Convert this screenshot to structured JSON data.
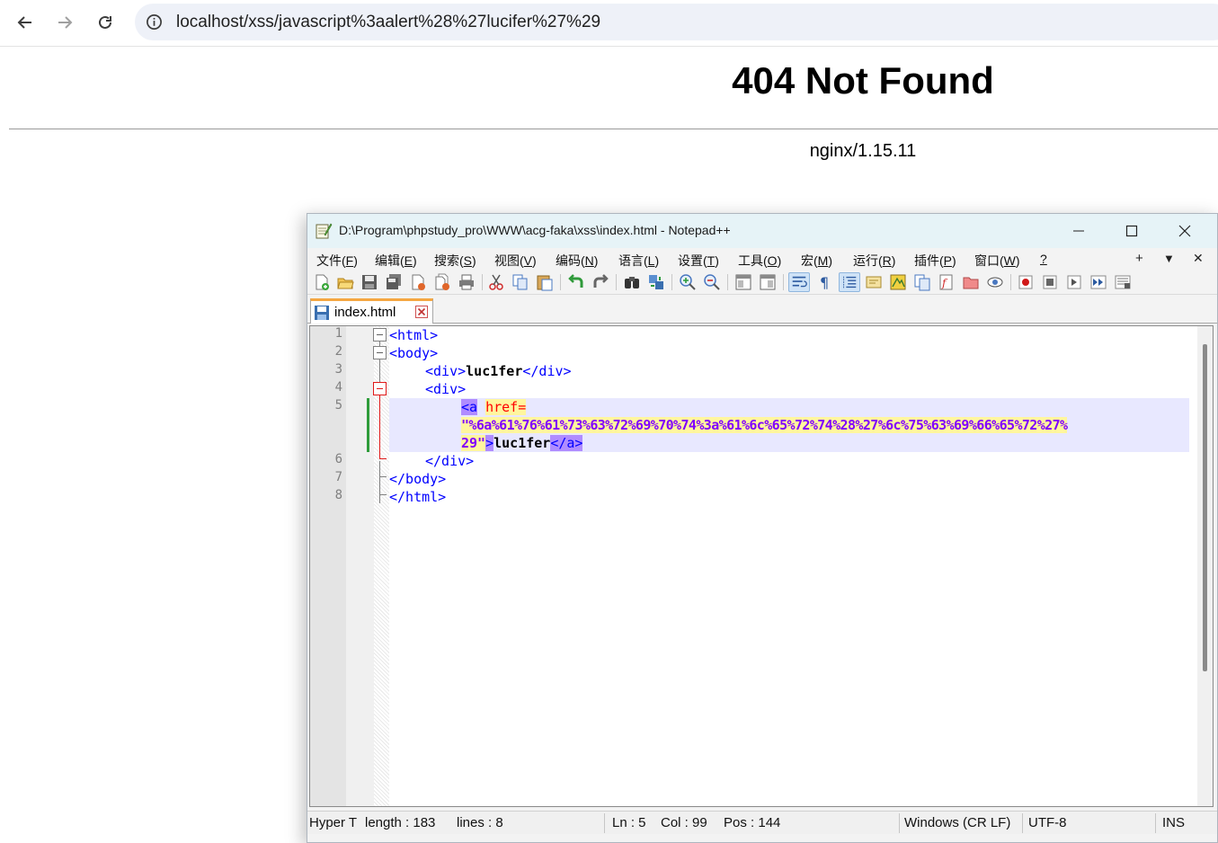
{
  "browser": {
    "url": "localhost/xss/javascript%3aalert%28%27lucifer%27%29"
  },
  "page": {
    "title": "404 Not Found",
    "server": "nginx/1.15.11"
  },
  "notepad": {
    "title": "D:\\Program\\phpstudy_pro\\WWW\\acg-faka\\xss\\index.html - Notepad++",
    "menu": [
      {
        "label": "文件(",
        "key": "F",
        "close": ")"
      },
      {
        "label": "编辑(",
        "key": "E",
        "close": ")"
      },
      {
        "label": "搜索(",
        "key": "S",
        "close": ")"
      },
      {
        "label": "视图(",
        "key": "V",
        "close": ")"
      },
      {
        "label": "编码(",
        "key": "N",
        "close": ")"
      },
      {
        "label": "语言(",
        "key": "L",
        "close": ")"
      },
      {
        "label": "设置(",
        "key": "T",
        "close": ")"
      },
      {
        "label": "工具(",
        "key": "O",
        "close": ")"
      },
      {
        "label": "宏(",
        "key": "M",
        "close": ")"
      },
      {
        "label": "运行(",
        "key": "R",
        "close": ")"
      },
      {
        "label": "插件(",
        "key": "P",
        "close": ")"
      },
      {
        "label": "窗口(",
        "key": "W",
        "close": ")"
      },
      {
        "label": "",
        "key": "?",
        "close": ""
      }
    ],
    "menu_right": {
      "plus": "+",
      "down": "▼",
      "close": "✕"
    },
    "tab": {
      "label": "index.html"
    },
    "line_numbers": [
      "1",
      "2",
      "3",
      "4",
      "5",
      "6",
      "7",
      "8"
    ],
    "code": {
      "l1": "<html>",
      "l2": "<body>",
      "l3_open": "<div>",
      "l3_text": "luc1fer",
      "l3_close": "</div>",
      "l4": "<div>",
      "l5_tag": "<a",
      "l5_attr": "href=",
      "l5_val_a": "\"%6a%61%76%61%73%63%72%69%70%74%3a%61%6c%65%72%74%28%27%6c%75%63%69%66%65%72%27%",
      "l5_val_b": "29\"",
      "l5_gt": ">",
      "l5_text": "luc1fer",
      "l5_close": "</a>",
      "l6": "</div>",
      "l7": "</body>",
      "l8": "</html>"
    },
    "status": {
      "type": "Hyper T",
      "length": "length : 183",
      "lines": "lines : 8",
      "ln": "Ln : 5",
      "col": "Col : 99",
      "pos": "Pos : 144",
      "eol": "Windows (CR LF)",
      "encoding": "UTF-8",
      "mode": "INS"
    }
  },
  "colors": {
    "tag": "#0000ff",
    "attr": "#ff0000",
    "value": "#8000ff",
    "tag_match_bg": "#b08cff",
    "string_match_bg": "#fff69e",
    "current_line_bg": "#e8e8ff",
    "change_marker": "#2e9c3a"
  }
}
